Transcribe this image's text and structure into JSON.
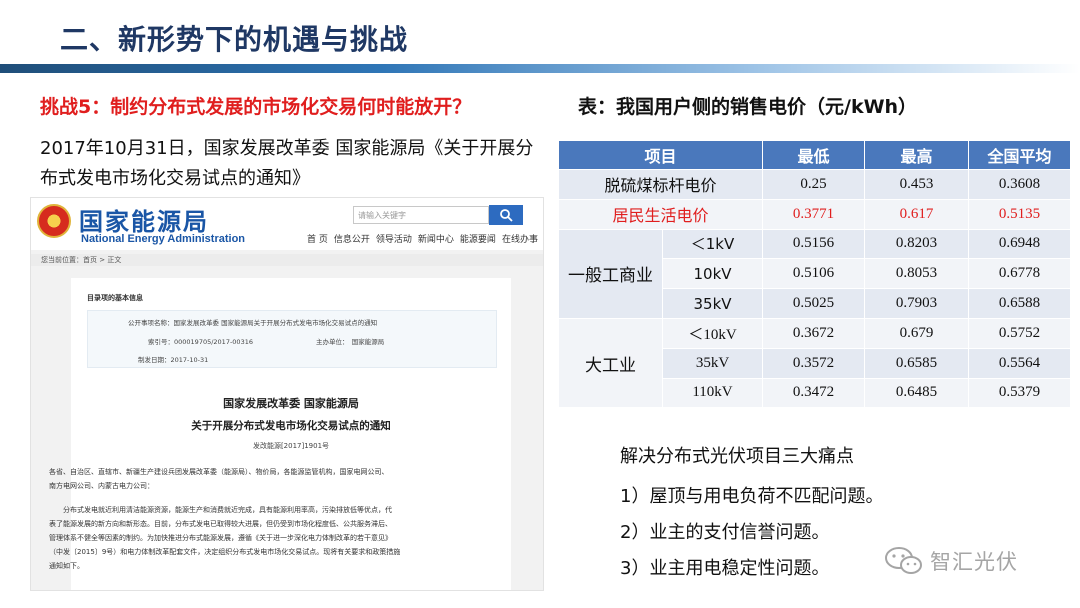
{
  "header": {
    "title": "二、新形势下的机遇与挑战"
  },
  "left": {
    "challenge": "挑战5：制约分布式发展的市场化交易何时能放开？",
    "intro": "2017年10月31日，国家发展改革委 国家能源局《关于开展分布式发电市场化交易试点的通知》"
  },
  "nea_page": {
    "logo_cn": "国家能源局",
    "logo_en": "National Energy Administration",
    "search_placeholder": "请输入关键字",
    "nav": [
      "首 页",
      "信息公开",
      "领导活动",
      "新闻中心",
      "能源要闻",
      "在线办事"
    ],
    "breadcrumb": "您当前位置：首页 > 正文",
    "info_label": "目录项的基本信息",
    "info_title": "公开事项名称：国家发展改革委 国家能源局关于开展分布式发电市场化交易试点的通知",
    "info_index": "索引号：000019705/2017-00316",
    "info_dept": "主办单位：　国家能源局",
    "info_date": "制发日期：2017-10-31",
    "doc_title1": "国家发展改革委 国家能源局",
    "doc_title2": "关于开展分布式发电市场化交易试点的通知",
    "doc_number": "发改能源[2017]1901号",
    "para1": "各省、自治区、直辖市、新疆生产建设兵团发展改革委（能源局）、物价局，各能源监管机构，国家电网公司、",
    "para1b": "南方电网公司、内蒙古电力公司：",
    "para2a": "　　分布式发电就近利用清洁能源资源，能源生产和消费就近完成，具有能源利用率高，污染排放低等优点，代",
    "para2b": "表了能源发展的新方向和新形态。目前，分布式发电已取得较大进展，但仍受到市场化程度低、公共服务滞后、",
    "para2c": "管理体系不健全等因素的制约。为加快推进分布式能源发展，遵循《关于进一步深化电力体制改革的若干意见》",
    "para2d": "（中发〔2015〕9号）和电力体制改革配套文件，决定组织分布式发电市场化交易试点。现将有关要求和政策措施",
    "para2e": "通知如下。"
  },
  "table": {
    "title": "表：我国用户侧的销售电价（元/kWh）",
    "headers": [
      "项目",
      "最低",
      "最高",
      "全国平均"
    ],
    "row_coal": {
      "label": "脱硫煤标杆电价",
      "values": [
        "0.25",
        "0.453",
        "0.3608"
      ]
    },
    "row_resident": {
      "label": "居民生活电价",
      "values": [
        "0.3771",
        "0.617",
        "0.5135"
      ]
    },
    "group_commercial": {
      "label": "一般工商业",
      "rows": [
        {
          "sub": "＜1kV",
          "values": [
            "0.5156",
            "0.8203",
            "0.6948"
          ]
        },
        {
          "sub": "10kV",
          "values": [
            "0.5106",
            "0.8053",
            "0.6778"
          ]
        },
        {
          "sub": "35kV",
          "values": [
            "0.5025",
            "0.7903",
            "0.6588"
          ]
        }
      ]
    },
    "group_industrial": {
      "label": "大工业",
      "rows": [
        {
          "sub": "＜10kV",
          "values": [
            "0.3672",
            "0.679",
            "0.5752"
          ]
        },
        {
          "sub": "35kV",
          "values": [
            "0.3572",
            "0.6585",
            "0.5564"
          ]
        },
        {
          "sub": "110kV",
          "values": [
            "0.3472",
            "0.6485",
            "0.5379"
          ]
        }
      ]
    },
    "colors": {
      "header_bg": "#4a78bc",
      "red": "#e01e1e",
      "purple": "#7d3f98"
    }
  },
  "pain_points": {
    "heading": "解决分布式光伏项目三大痛点",
    "items": [
      "1）屋顶与用电负荷不匹配问题。",
      "2）业主的支付信誉问题。",
      "3）业主用电稳定性问题。"
    ]
  },
  "watermark": {
    "text": "智汇光伏",
    "icon": "wechat-icon"
  }
}
